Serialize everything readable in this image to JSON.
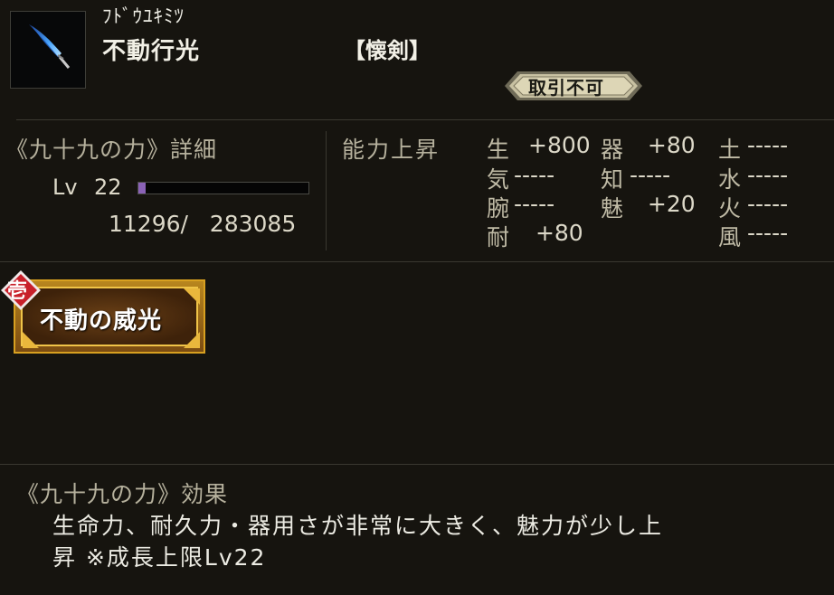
{
  "item": {
    "icon": "blue-blade-icon",
    "reading": "ﾌﾄﾞｳﾕｷﾐﾂ",
    "name": "不動行光",
    "category": "【懐剣】",
    "trade_status": "取引不可"
  },
  "detail": {
    "title": "《九十九の力》詳細",
    "level_label": "Lv",
    "level": "22",
    "exp_text": "11296/   283085",
    "exp_fraction": 0.04
  },
  "stats": {
    "heading": "能力上昇",
    "items": [
      {
        "key": "生",
        "value": "+800"
      },
      {
        "key": "器",
        "value": "  +80"
      },
      {
        "key": "土",
        "value": "-----"
      },
      {
        "key": "気",
        "value": "-----"
      },
      {
        "key": "知",
        "value": "-----"
      },
      {
        "key": "水",
        "value": "-----"
      },
      {
        "key": "腕",
        "value": "-----"
      },
      {
        "key": "魅",
        "value": "  +20"
      },
      {
        "key": "火",
        "value": "-----"
      },
      {
        "key": "耐",
        "value": " +80"
      },
      {
        "key": "風",
        "value": "-----"
      }
    ]
  },
  "skill": {
    "badge": "壱",
    "label": "不動の威光"
  },
  "effect": {
    "title": "《九十九の力》効果",
    "line1": "生命力、耐久力・器用さが非常に大きく、魅力が少し上",
    "line2": "昇 ※成長上限Lv22"
  },
  "colors": {
    "background": "#16140f",
    "exp_fill": "#8a62b6",
    "skill_border": "#d8a020",
    "badge": "#c8202a"
  }
}
